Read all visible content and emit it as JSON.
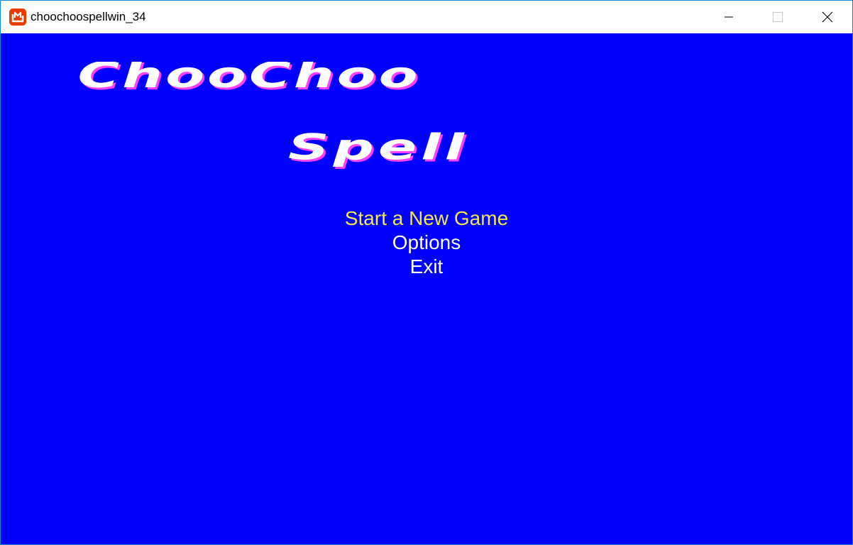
{
  "window": {
    "title": "choochoospellwin_34",
    "app_icon": "monogame-icon",
    "controls": [
      "minimize-icon",
      "maximize-icon",
      "close-icon"
    ]
  },
  "game": {
    "background_color": "#0000ff",
    "logo": {
      "line1": "ChooChoo",
      "line2": "Spell"
    },
    "menu": {
      "items": [
        {
          "label": "Start a New Game",
          "selected": true
        },
        {
          "label": "Options",
          "selected": false
        },
        {
          "label": "Exit",
          "selected": false
        }
      ],
      "selected_color": "#f2e94e",
      "normal_color": "#ffffff"
    }
  }
}
